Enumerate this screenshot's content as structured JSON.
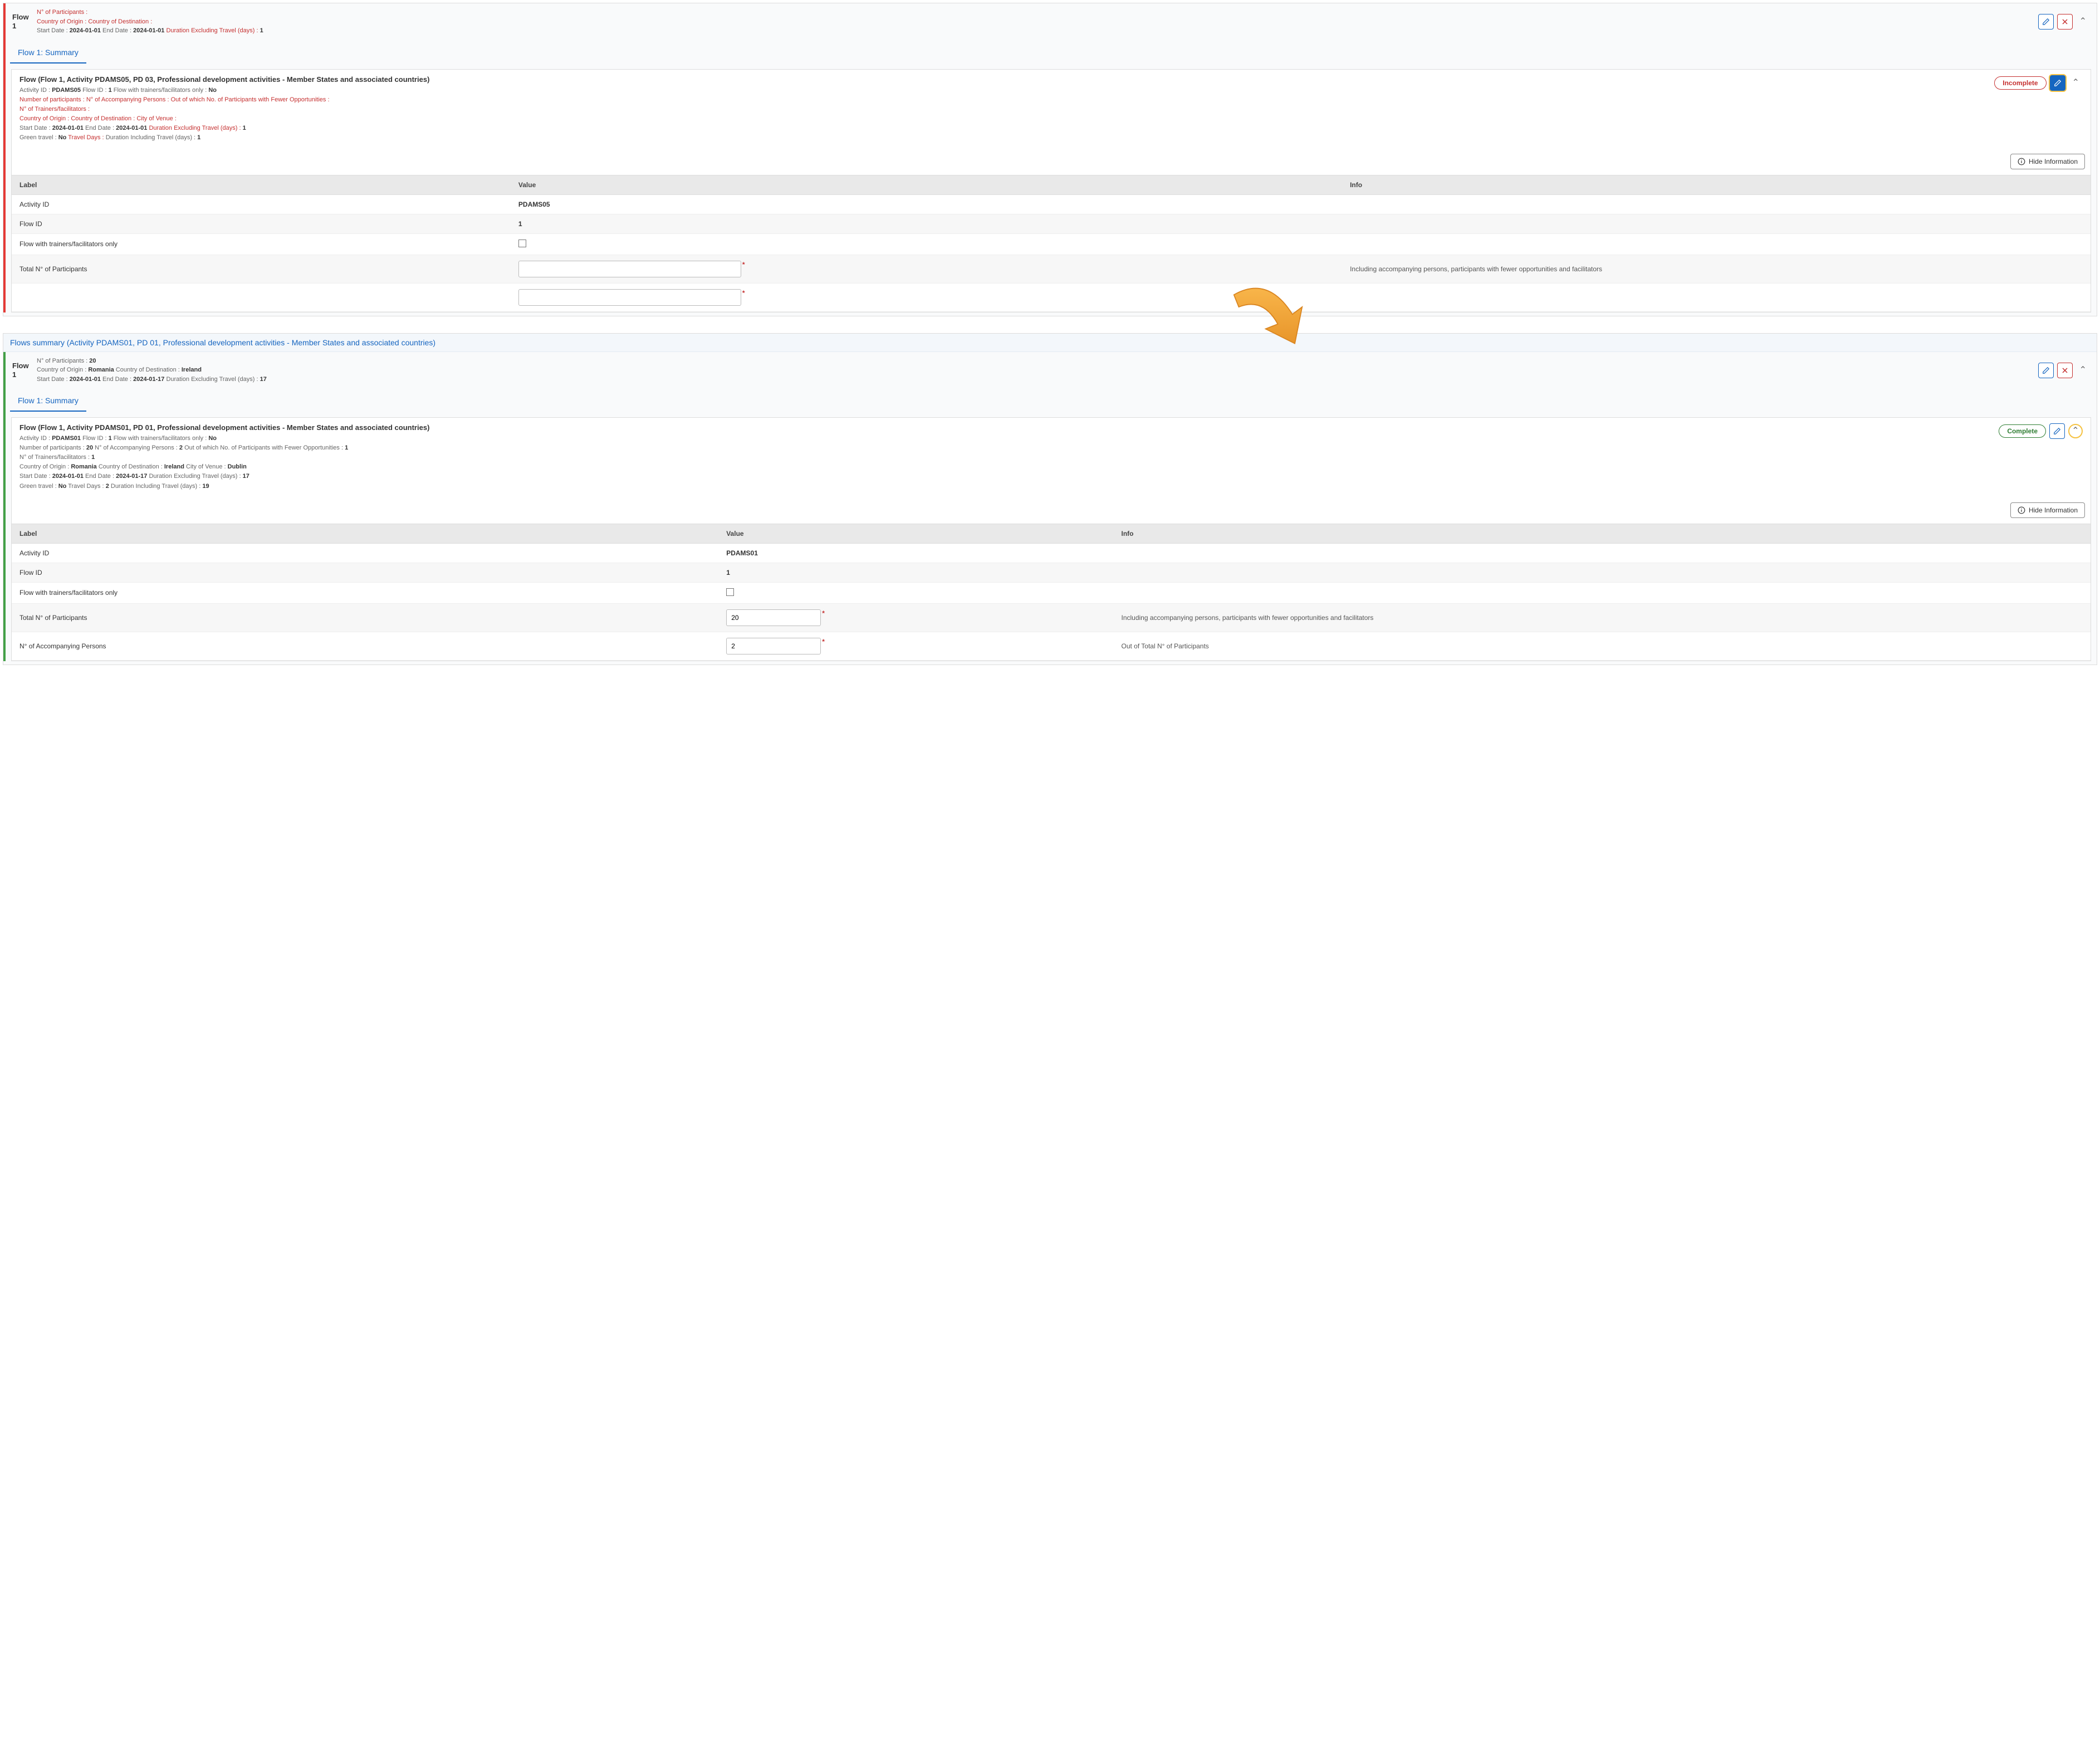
{
  "colors": {
    "red": "#c53030",
    "blue": "#1565c0",
    "green": "#2e7d32",
    "orange": "#f0a030"
  },
  "top": {
    "flow_label_a": "Flow",
    "flow_label_b": "1",
    "participants_label": "N° of Participants :",
    "origin_label": "Country of Origin :",
    "dest_label": "Country of Destination :",
    "start_label": "Start Date :",
    "start_value": "2024-01-01",
    "end_label": "End Date :",
    "end_value": "2024-01-01",
    "duration_label": "Duration Excluding Travel (days) :",
    "duration_value": "1",
    "summary_link": "Flow 1: Summary",
    "detail": {
      "title": "Flow (Flow 1, Activity PDAMS05, PD 03, Professional development activities - Member States and associated countries)",
      "activity_id_label": "Activity ID :",
      "activity_id": "PDAMS05",
      "flow_id_label": "Flow ID :",
      "flow_id": "1",
      "trainers_only_label": "Flow with trainers/facilitators only :",
      "trainers_only": "No",
      "nparticipants_label": "Number of participants :",
      "naccomp_label": "N° of Accompanying Persons :",
      "fewer_opp_label": "Out of which No. of Participants with Fewer Opportunities :",
      "ntrainers_label": "N° of Trainers/facilitators :",
      "origin_label": "Country of Origin :",
      "dest_label": "Country of Destination :",
      "city_label": "City of Venue :",
      "start_label": "Start Date :",
      "start_value": "2024-01-01",
      "end_label": "End Date :",
      "end_value": "2024-01-01",
      "duration_label": "Duration Excluding Travel (days) :",
      "duration_value": "1",
      "green_label": "Green travel :",
      "green_value": "No",
      "travel_days_label": "Travel Days :",
      "duration_incl_label": "Duration Including Travel (days) :",
      "duration_incl_value": "1",
      "status": "Incomplete"
    },
    "hide_info": "Hide Information",
    "table": {
      "headers": {
        "label": "Label",
        "value": "Value",
        "info": "Info"
      },
      "rows": {
        "activity_id": {
          "label": "Activity ID",
          "value": "PDAMS05"
        },
        "flow_id": {
          "label": "Flow ID",
          "value": "1"
        },
        "trainers_only": {
          "label": "Flow with trainers/facilitators only"
        },
        "total_participants": {
          "label": "Total N° of Participants",
          "info": "Including accompanying persons, participants with fewer opportunities and facilitators"
        }
      }
    }
  },
  "bottom": {
    "flows_summary_title": "Flows summary (Activity PDAMS01, PD 01, Professional development activities - Member States and associated countries)",
    "flow_label_a": "Flow",
    "flow_label_b": "1",
    "participants_label": "N° of Participants :",
    "participants_value": "20",
    "origin_label": "Country of Origin :",
    "origin_value": "Romania",
    "dest_label": "Country of Destination :",
    "dest_value": "Ireland",
    "start_label": "Start Date :",
    "start_value": "2024-01-01",
    "end_label": "End Date :",
    "end_value": "2024-01-17",
    "duration_label": "Duration Excluding Travel (days) :",
    "duration_value": "17",
    "summary_link": "Flow 1: Summary",
    "detail": {
      "title": "Flow (Flow 1, Activity PDAMS01, PD 01, Professional development activities - Member States and associated countries)",
      "activity_id_label": "Activity ID :",
      "activity_id": "PDAMS01",
      "flow_id_label": "Flow ID :",
      "flow_id": "1",
      "trainers_only_label": "Flow with trainers/facilitators only :",
      "trainers_only": "No",
      "nparticipants_label": "Number of participants :",
      "nparticipants": "20",
      "naccomp_label": "N° of Accompanying Persons :",
      "naccomp": "2",
      "fewer_opp_label": "Out of which No. of Participants with Fewer Opportunities :",
      "fewer_opp": "1",
      "ntrainers_label": "N° of Trainers/facilitators :",
      "ntrainers": "1",
      "origin_label": "Country of Origin :",
      "origin_value": "Romania",
      "dest_label": "Country of Destination :",
      "dest_value": "Ireland",
      "city_label": "City of Venue :",
      "city_value": "Dublin",
      "start_label": "Start Date :",
      "start_value": "2024-01-01",
      "end_label": "End Date :",
      "end_value": "2024-01-17",
      "duration_label": "Duration Excluding Travel (days) :",
      "duration_value": "17",
      "green_label": "Green travel :",
      "green_value": "No",
      "travel_days_label": "Travel Days :",
      "travel_days_value": "2",
      "duration_incl_label": "Duration Including Travel (days) :",
      "duration_incl_value": "19",
      "status": "Complete"
    },
    "hide_info": "Hide Information",
    "table": {
      "headers": {
        "label": "Label",
        "value": "Value",
        "info": "Info"
      },
      "rows": {
        "activity_id": {
          "label": "Activity ID",
          "value": "PDAMS01"
        },
        "flow_id": {
          "label": "Flow ID",
          "value": "1"
        },
        "trainers_only": {
          "label": "Flow with trainers/facilitators only"
        },
        "total_participants": {
          "label": "Total N° of Participants",
          "value": "20",
          "info": "Including accompanying persons, participants with fewer opportunities and facilitators"
        },
        "n_accompanying": {
          "label": "N° of Accompanying Persons",
          "value": "2",
          "info": "Out of Total N° of Participants"
        }
      }
    }
  }
}
